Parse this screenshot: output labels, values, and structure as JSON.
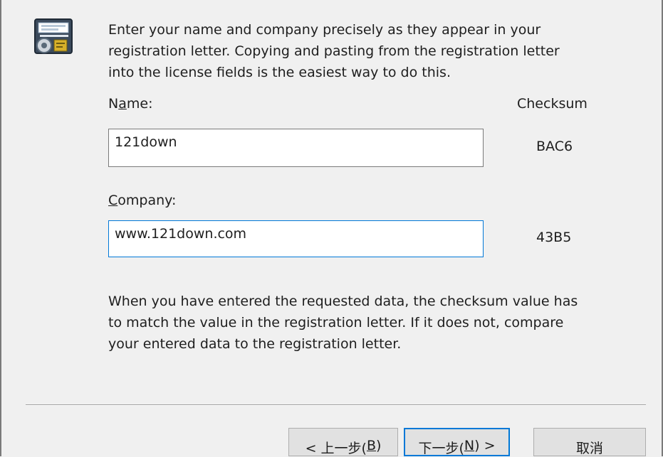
{
  "dialog": {
    "intro_text": "Enter your name and company precisely as they appear in your\nregistration letter.  Copying and pasting from the registration letter\ninto the license fields is the easiest way to do this.",
    "name_label": {
      "pre": "N",
      "mnemonic": "a",
      "post": "me:"
    },
    "company_label": {
      "pre": "",
      "mnemonic": "C",
      "post": "ompany:"
    },
    "checksum_header": "Checksum",
    "name_value": "121down",
    "company_value": "www.121down.com",
    "name_checksum": "BAC6",
    "company_checksum": "43B5",
    "note_text": "When you have entered the requested data, the checksum value has\nto match the value in the registration letter.  If it does not, compare\nyour entered data to the registration letter."
  },
  "buttons": {
    "back": {
      "pre": "< 上一步(",
      "mnemonic": "B",
      "post": ")"
    },
    "next": {
      "pre": "下一步(",
      "mnemonic": "N",
      "post": ") >"
    },
    "cancel": "取消"
  },
  "icons": {
    "app_icon": "license-key-icon"
  },
  "colors": {
    "focus_accent": "#0078d7",
    "background": "#f0f0f0"
  }
}
